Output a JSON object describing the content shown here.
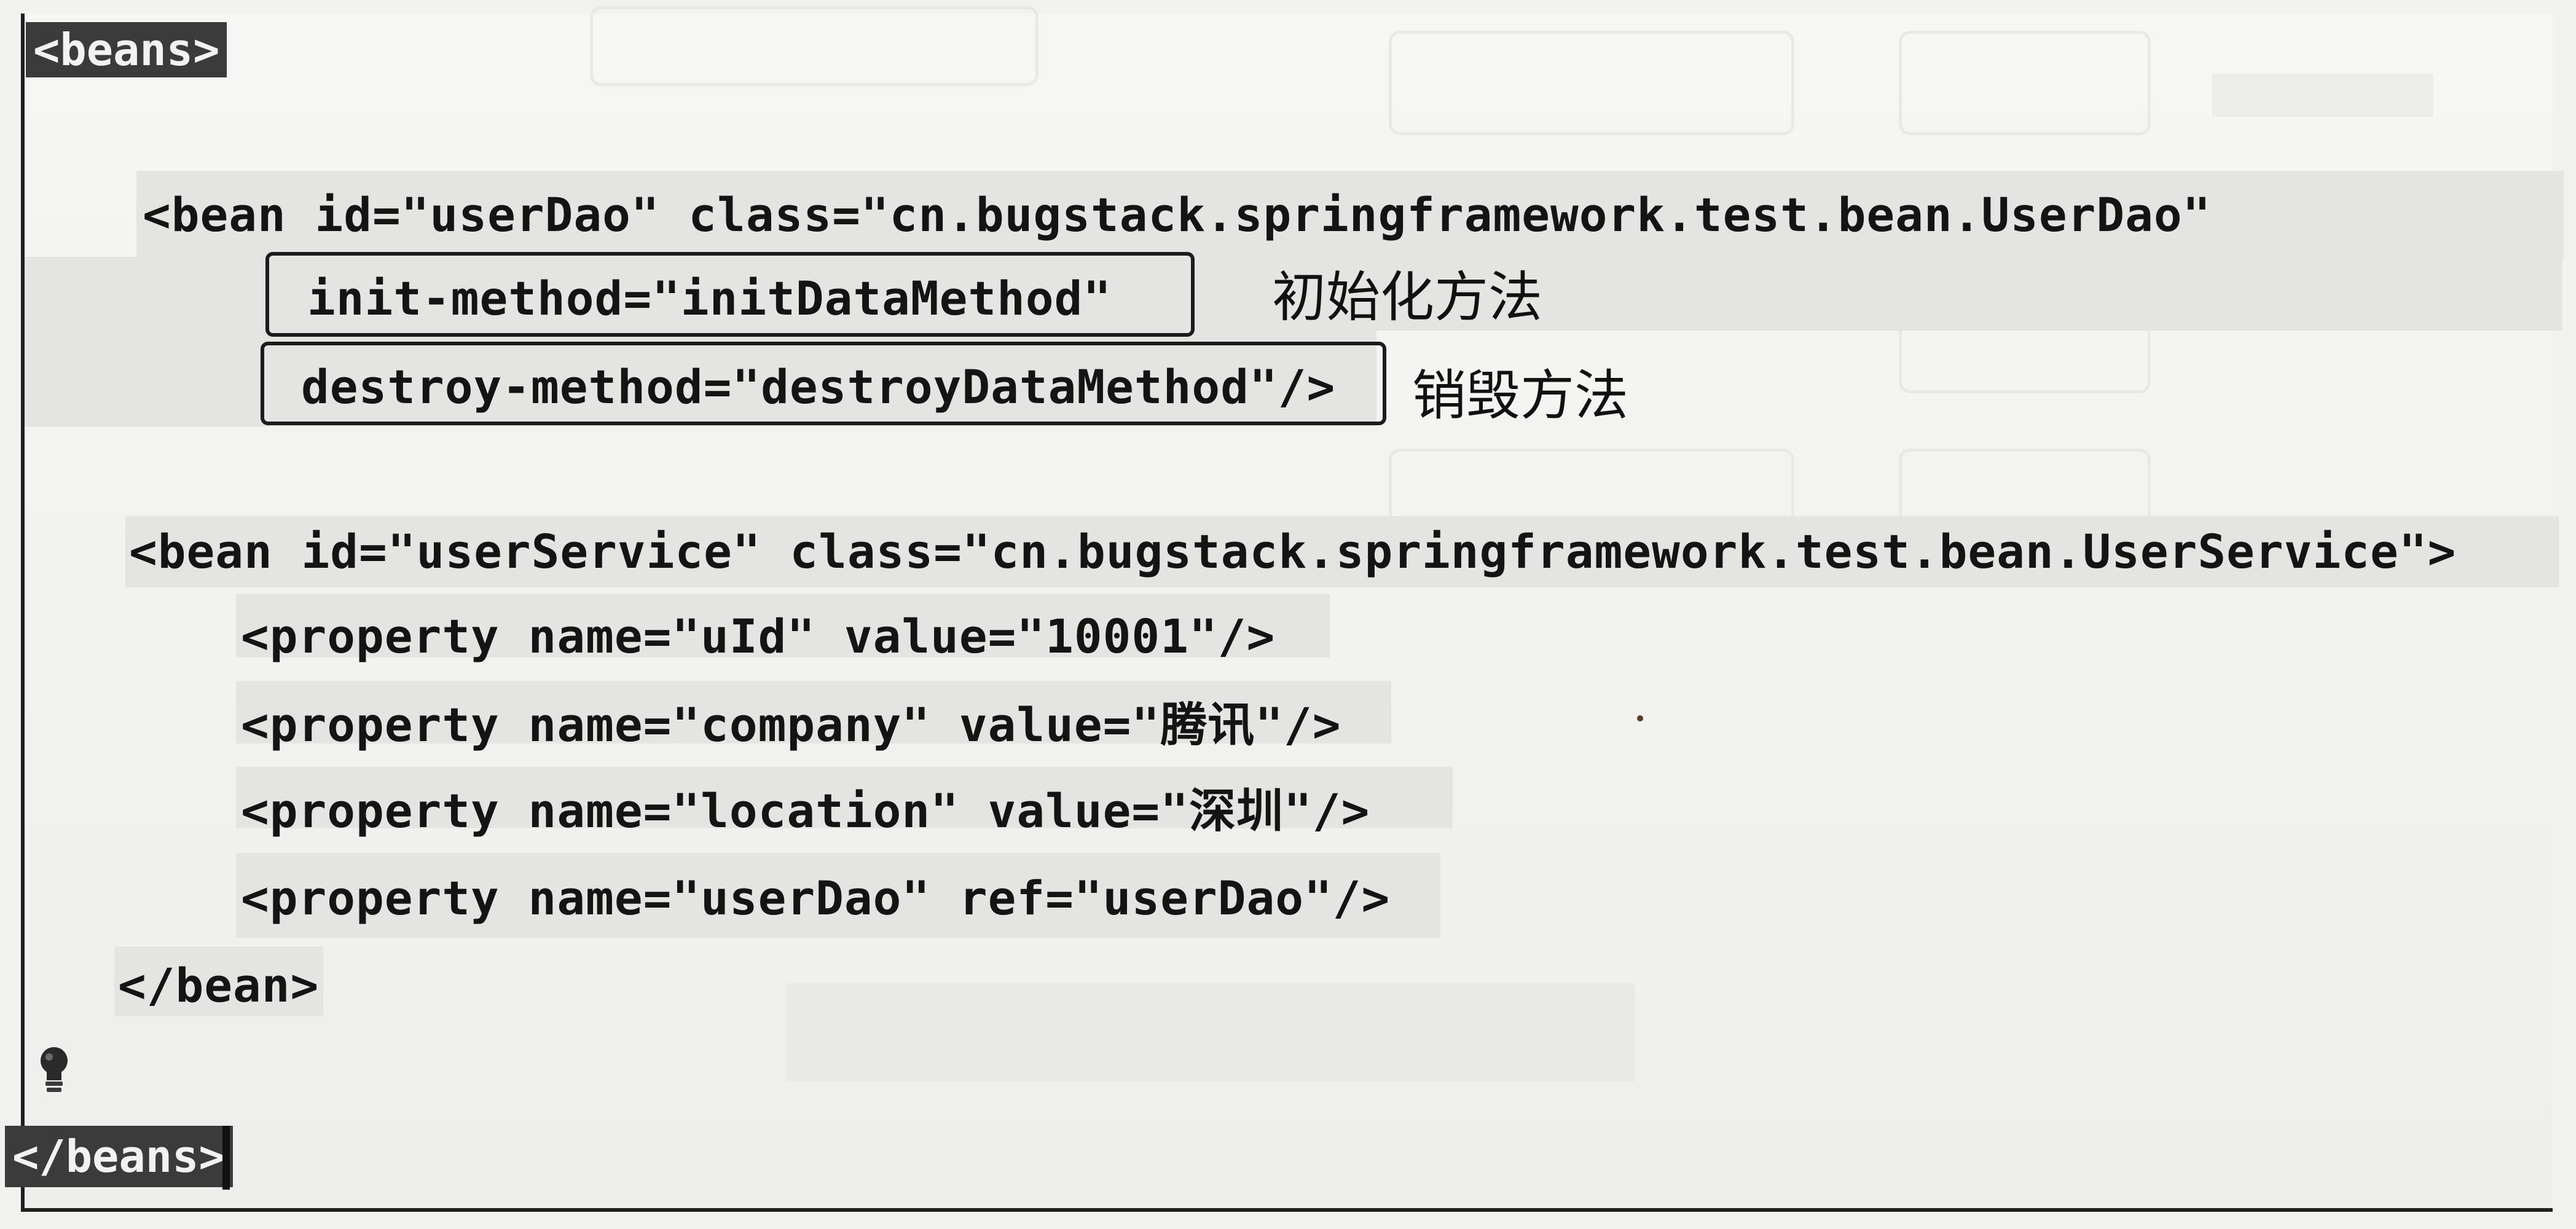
{
  "code": {
    "beans_open": "<beans>",
    "beans_close": "</beans>",
    "bean_user_dao": {
      "open_line": "<bean id=\"userDao\" class=\"cn.bugstack.springframework.test.bean.UserDao\"",
      "init_method": "init-method=\"initDataMethod\"",
      "destroy_method": "destroy-method=\"destroyDataMethod\"/>"
    },
    "bean_user_service": {
      "open_line": "<bean id=\"userService\" class=\"cn.bugstack.springframework.test.bean.UserService\">",
      "properties": [
        "<property name=\"uId\" value=\"10001\"/>",
        "<property name=\"company\" value=\"腾讯\"/>",
        "<property name=\"location\" value=\"深圳\"/>",
        "<property name=\"userDao\" ref=\"userDao\"/>"
      ],
      "close_line": "</bean>"
    }
  },
  "annotations": {
    "init": "初始化方法",
    "destroy": "销毁方法"
  },
  "icons": {
    "hint": "lightbulb-icon"
  },
  "colors": {
    "text": "#141414",
    "tag_highlight": "#3b3b3b",
    "line_shade": "#e4e4e2",
    "paper": "#f1f1ef"
  }
}
